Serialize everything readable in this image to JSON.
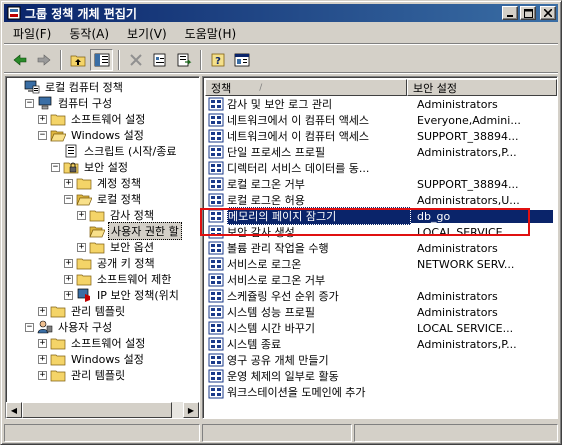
{
  "window": {
    "title": "그룹 정책 개체 편집기",
    "controls": {
      "minimize": "_",
      "maximize": "□",
      "close": "×"
    }
  },
  "menu": [
    "파일(F)",
    "동작(A)",
    "보기(V)",
    "도움말(H)"
  ],
  "toolbar": {
    "icons": [
      "back-arrow-icon",
      "forward-arrow-icon",
      "up-folder-icon",
      "show-tree-icon",
      "delete-icon",
      "properties-icon",
      "export-list-icon",
      "help-icon",
      "console-icon"
    ]
  },
  "tree": {
    "items": [
      {
        "label": "로컬 컴퓨터 정책",
        "level": 0,
        "expander": "",
        "icon": "computer-policy-icon"
      },
      {
        "label": "컴퓨터 구성",
        "level": 1,
        "expander": "−",
        "icon": "computer-icon"
      },
      {
        "label": "소프트웨어 설정",
        "level": 2,
        "expander": "+",
        "icon": "folder-icon"
      },
      {
        "label": "Windows 설정",
        "level": 2,
        "expander": "−",
        "icon": "folder-open-icon"
      },
      {
        "label": "스크립트 (시작/종료",
        "level": 3,
        "expander": "",
        "icon": "script-icon"
      },
      {
        "label": "보안 설정",
        "level": 3,
        "expander": "−",
        "icon": "security-icon"
      },
      {
        "label": "계정 정책",
        "level": 4,
        "expander": "+",
        "icon": "folder-icon"
      },
      {
        "label": "로컬 정책",
        "level": 4,
        "expander": "−",
        "icon": "folder-open-icon"
      },
      {
        "label": "감사 정책",
        "level": 5,
        "expander": "+",
        "icon": "folder-icon"
      },
      {
        "label": "사용자 권한 할",
        "level": 5,
        "expander": "",
        "icon": "folder-open-icon",
        "selected": true
      },
      {
        "label": "보안 옵션",
        "level": 5,
        "expander": "+",
        "icon": "folder-icon"
      },
      {
        "label": "공개 키 정책",
        "level": 4,
        "expander": "+",
        "icon": "folder-icon"
      },
      {
        "label": "소프트웨어 제한",
        "level": 4,
        "expander": "+",
        "icon": "folder-icon"
      },
      {
        "label": "IP 보안 정책(위치",
        "level": 4,
        "expander": "+",
        "icon": "ip-security-icon"
      },
      {
        "label": "관리 템플릿",
        "level": 2,
        "expander": "+",
        "icon": "folder-icon"
      },
      {
        "label": "사용자 구성",
        "level": 1,
        "expander": "−",
        "icon": "user-icon"
      },
      {
        "label": "소프트웨어 설정",
        "level": 2,
        "expander": "+",
        "icon": "folder-icon"
      },
      {
        "label": "Windows 설정",
        "level": 2,
        "expander": "+",
        "icon": "folder-icon"
      },
      {
        "label": "관리 템플릿",
        "level": 2,
        "expander": "+",
        "icon": "folder-icon"
      }
    ]
  },
  "list": {
    "columns": [
      "정책",
      "보안 설정"
    ],
    "sort_indicator": "/",
    "rows": [
      {
        "policy": "감사 및 보안 로그 관리",
        "setting": "Administrators"
      },
      {
        "policy": "네트워크에서 이 컴퓨터 액세스",
        "setting": "Everyone,Admini..."
      },
      {
        "policy": "네트워크에서 이 컴퓨터 액세스",
        "setting": "SUPPORT_38894..."
      },
      {
        "policy": "단일 프로세스 프로필",
        "setting": "Administrators,P..."
      },
      {
        "policy": "디렉터리 서비스 데이터를 동...",
        "setting": ""
      },
      {
        "policy": "로컬 로그온 거부",
        "setting": "SUPPORT_38894..."
      },
      {
        "policy": "로컬 로그온 허용",
        "setting": "Administrators,U..."
      },
      {
        "policy": "메모리의 페이지 잠그기",
        "setting": "db_go",
        "selected": true
      },
      {
        "policy": "보안 감사 생성",
        "setting": "LOCAL SERVICE..."
      },
      {
        "policy": "볼륨 관리 작업을 수행",
        "setting": "Administrators"
      },
      {
        "policy": "서비스로 로그온",
        "setting": "NETWORK SERV..."
      },
      {
        "policy": "서비스로 로그온 거부",
        "setting": ""
      },
      {
        "policy": "스케쥴링 우선 순위 증가",
        "setting": "Administrators"
      },
      {
        "policy": "시스템 성능 프로필",
        "setting": "Administrators"
      },
      {
        "policy": "시스템 시간 바꾸기",
        "setting": "LOCAL SERVICE..."
      },
      {
        "policy": "시스템 종료",
        "setting": "Administrators,P..."
      },
      {
        "policy": "영구 공유 개체 만들기",
        "setting": ""
      },
      {
        "policy": "운영 체제의 일부로 활동",
        "setting": ""
      },
      {
        "policy": "워크스테이션을 도메인에 추가",
        "setting": ""
      }
    ]
  },
  "colors": {
    "title_start": "#0a246a",
    "title_end": "#3a6ea5",
    "selection": "#0a246a",
    "highlight": "#e01010"
  }
}
